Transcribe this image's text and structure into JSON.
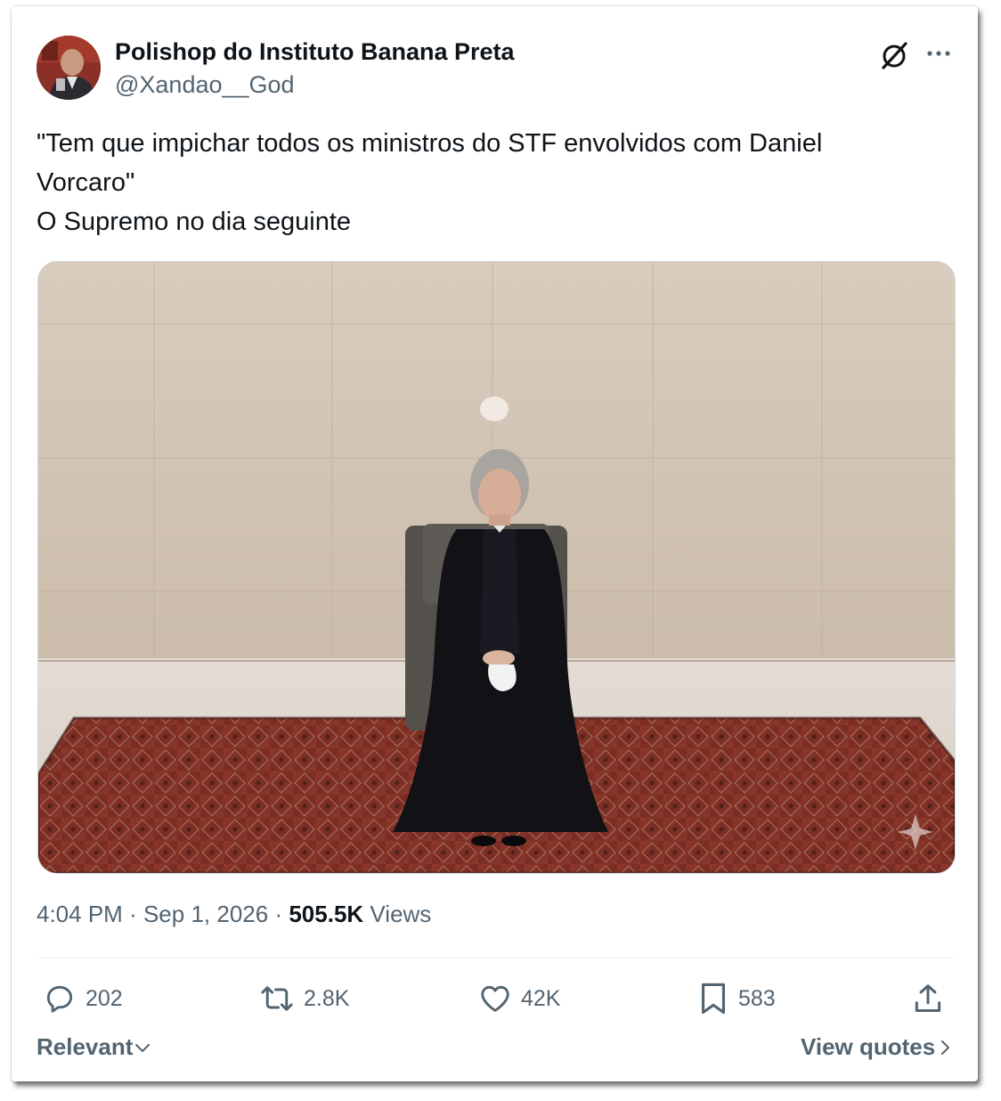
{
  "author": {
    "display_name": "Polishop do Instituto Banana Preta",
    "handle": "@Xandao__God"
  },
  "header_icons": [
    "grok-icon",
    "more-icon"
  ],
  "tweet": {
    "lines": [
      "\"Tem que impichar todos os ministros do STF envolvidos com Daniel",
      "Vorcaro\"",
      "O Supremo no dia seguinte"
    ]
  },
  "meta": {
    "time": "4:04 PM",
    "date": "Sep 1, 2026",
    "separator": "·",
    "views_count": "505.5K",
    "views_label": "Views"
  },
  "actions": {
    "replies": "202",
    "reposts": "2.8K",
    "likes": "42K",
    "bookmarks": "583",
    "icons": [
      "reply-icon",
      "retweet-icon",
      "heart-icon",
      "bookmark-icon",
      "share-icon"
    ]
  },
  "footer": {
    "sort_label": "Relevant",
    "view_quotes_label": "View quotes"
  },
  "colors": {
    "text_primary": "#0f1419",
    "text_secondary": "#536471",
    "border": "#cfd9de"
  }
}
